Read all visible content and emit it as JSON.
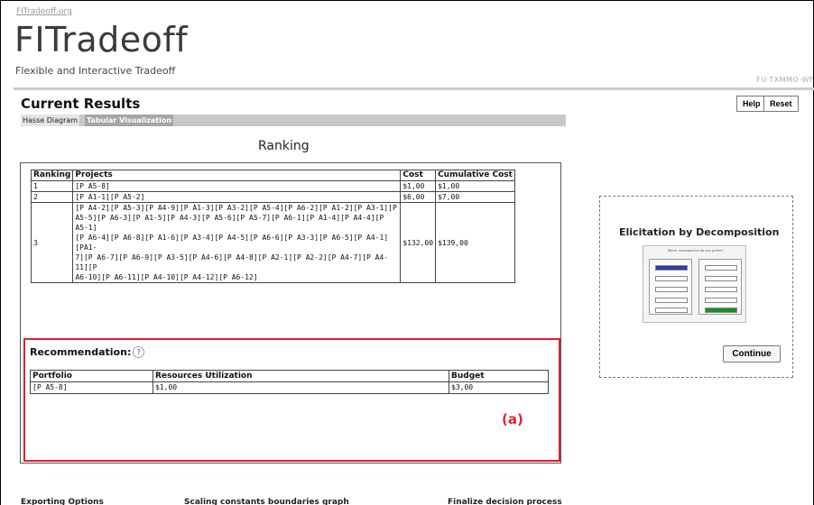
{
  "header": {
    "site_link": "FITradeoff.org",
    "logo": "FITradeoff",
    "tagline": "Flexible and Interactive Tradeoff",
    "code": "FU-TXMMO-WF"
  },
  "page_title": "Current Results",
  "buttons": {
    "help": "Help",
    "reset": "Reset",
    "continue": "Continue"
  },
  "tabs": [
    {
      "label": "Hasse Diagram"
    },
    {
      "label": "Tabular Visualization"
    }
  ],
  "ranking": {
    "title": "Ranking",
    "headers": [
      "Ranking",
      "Projects",
      "Cost",
      "Cumulative Cost"
    ],
    "rows": [
      {
        "rank": "1",
        "projects": "[P A5-8]",
        "cost": "$1,00",
        "cumulative": "$1,00"
      },
      {
        "rank": "2",
        "projects": "[P A1-1][P A5-2]",
        "cost": "$6,00",
        "cumulative": "$7,00"
      },
      {
        "rank": "3",
        "projects_lines": [
          "[P A4-2][P A5-3][P A4-9][P A1-3][P A3-2][P A5-4][P A6-2][P A1-2][P A3-1][P",
          "A5-5][P A6-3][P A1-5][P A4-3][P A5-6][P A5-7][P A6-1][P A1-4][P A4-4][P A5-1]",
          "[P A6-4][P A6-8][P A1-6][P A3-4][P A4-5][P A6-6][P A3-3][P A6-5][P A4-1][PA1-",
          "7][P A6-7][P A6-9][P A3-5][P A4-6][P A4-8][P A2-1][P A2-2][P A4-7][P A4-11][P",
          "A6-10][P A6-11][P A4-10][P A4-12][P A6-12]"
        ],
        "cost": "$132,00",
        "cumulative": "$139,00"
      }
    ]
  },
  "recommendation": {
    "label": "Recommendation:",
    "help_glyph": "?",
    "headers": [
      "Portfolio",
      "Resources Utilization",
      "Budget"
    ],
    "row": {
      "portfolio": "[P A5-8]",
      "resources": "$1,00",
      "budget": "$3,00"
    }
  },
  "annotation": "(a)",
  "side_panel": {
    "title": "Elicitation by Decomposition",
    "thumb_heading": "Which consequence do you prefer?"
  },
  "bottom_sections": [
    "Exporting Options",
    "Scaling constants boundaries graph",
    "Finalize decision process"
  ],
  "colors": {
    "highlight": "#e0222a",
    "tab_active": "#a5a5a5"
  }
}
